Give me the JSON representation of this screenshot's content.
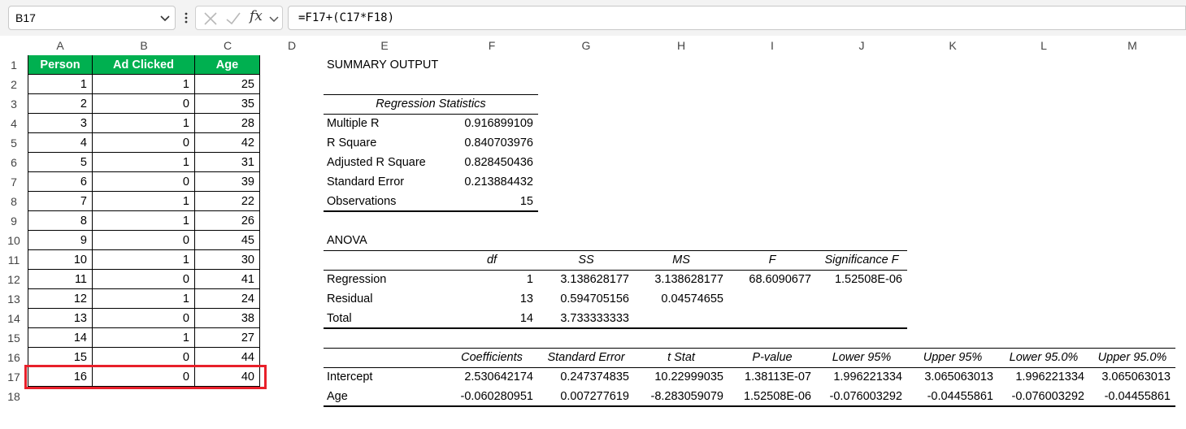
{
  "formula_bar": {
    "name_box": "B17",
    "formula": "=F17+(C17*F18)",
    "fx_label": "fx",
    "icons": [
      "chevron-down-icon",
      "more-vertical-icon",
      "cancel-icon",
      "check-icon",
      "function-icon",
      "chevron-down-icon"
    ]
  },
  "columns": [
    "A",
    "B",
    "C",
    "D",
    "E",
    "F",
    "G",
    "H",
    "I",
    "J",
    "K",
    "L",
    "M"
  ],
  "rows": [
    "1",
    "2",
    "3",
    "4",
    "5",
    "6",
    "7",
    "8",
    "9",
    "10",
    "11",
    "12",
    "13",
    "14",
    "15",
    "16",
    "17",
    "18"
  ],
  "table": {
    "headers": [
      "Person",
      "Ad Clicked",
      "Age"
    ],
    "header_color": "#00b050",
    "rows": [
      [
        "1",
        "1",
        "25"
      ],
      [
        "2",
        "0",
        "35"
      ],
      [
        "3",
        "1",
        "28"
      ],
      [
        "4",
        "0",
        "42"
      ],
      [
        "5",
        "1",
        "31"
      ],
      [
        "6",
        "0",
        "39"
      ],
      [
        "7",
        "1",
        "22"
      ],
      [
        "8",
        "1",
        "26"
      ],
      [
        "9",
        "0",
        "45"
      ],
      [
        "10",
        "1",
        "30"
      ],
      [
        "11",
        "0",
        "41"
      ],
      [
        "12",
        "1",
        "24"
      ],
      [
        "13",
        "0",
        "38"
      ],
      [
        "14",
        "1",
        "27"
      ],
      [
        "15",
        "0",
        "44"
      ],
      [
        "16",
        "0",
        "40"
      ]
    ]
  },
  "selection_color": "#e8202a",
  "summary": {
    "title": "SUMMARY OUTPUT",
    "regression_stats_title": "Regression Statistics",
    "regression_stats": [
      [
        "Multiple R",
        "0.916899109"
      ],
      [
        "R Square",
        "0.840703976"
      ],
      [
        "Adjusted R Square",
        "0.828450436"
      ],
      [
        "Standard Error",
        "0.213884432"
      ],
      [
        "Observations",
        "15"
      ]
    ],
    "anova_title": "ANOVA",
    "anova_headers": [
      "df",
      "SS",
      "MS",
      "F",
      "Significance F"
    ],
    "anova_rows": [
      [
        "Regression",
        "1",
        "3.138628177",
        "3.138628177",
        "68.6090677",
        "1.52508E-06"
      ],
      [
        "Residual",
        "13",
        "0.594705156",
        "0.04574655",
        "",
        ""
      ],
      [
        "Total",
        "14",
        "3.733333333",
        "",
        "",
        ""
      ]
    ],
    "coef_headers": [
      "Coefficients",
      "Standard Error",
      "t Stat",
      "P-value",
      "Lower 95%",
      "Upper 95%",
      "Lower 95.0%",
      "Upper 95.0%"
    ],
    "coef_rows": [
      [
        "Intercept",
        "2.530642174",
        "0.247374835",
        "10.22999035",
        "1.38113E-07",
        "1.996221334",
        "3.065063013",
        "1.996221334",
        "3.065063013"
      ],
      [
        "Age",
        "-0.060280951",
        "0.007277619",
        "-8.283059079",
        "1.52508E-06",
        "-0.076003292",
        "-0.04455861",
        "-0.076003292",
        "-0.04455861"
      ]
    ]
  }
}
